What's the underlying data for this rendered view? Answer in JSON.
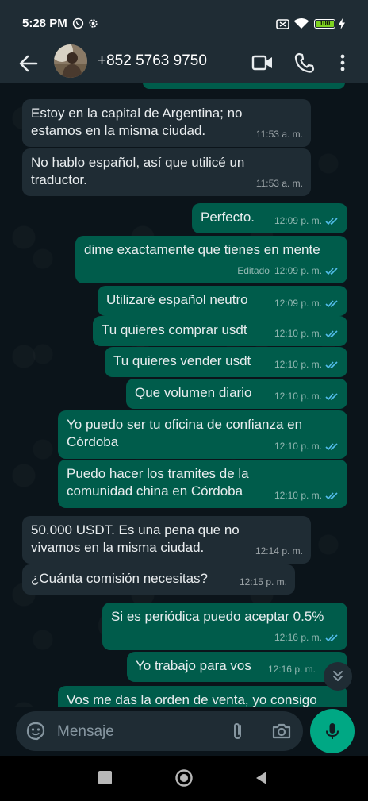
{
  "status_bar": {
    "time": "5:28 PM",
    "battery": "100",
    "icons": [
      "whatsapp-icon",
      "settings-gear-icon",
      "nfc-icon",
      "wifi-icon",
      "battery-icon",
      "charging-icon"
    ]
  },
  "header": {
    "contact": "+852 5763 9750",
    "icons": [
      "back-arrow-icon",
      "video-call-icon",
      "voice-call-icon",
      "more-vertical-icon"
    ]
  },
  "messages": [
    {
      "dir": "in",
      "text": "Estoy en la capital de Argentina; no\nestamos en la misma ciudad.",
      "time": "11:53 a. m."
    },
    {
      "dir": "in",
      "text": "No hablo español, así que utilicé un\ntraductor.",
      "time": "11:53 a. m."
    },
    {
      "dir": "out",
      "text": "Perfecto.",
      "time": "12:09 p. m.",
      "read": true
    },
    {
      "dir": "out",
      "text": "dime exactamente que tienes en mente",
      "time": "12:09 p. m.",
      "edited": "Editado",
      "read": true
    },
    {
      "dir": "out",
      "text": "Utilizaré español neutro",
      "time": "12:09 p. m.",
      "read": true
    },
    {
      "dir": "out",
      "text": "Tu quieres comprar usdt",
      "time": "12:10 p. m.",
      "read": true
    },
    {
      "dir": "out",
      "text": "Tu quieres vender usdt",
      "time": "12:10 p. m.",
      "read": true
    },
    {
      "dir": "out",
      "text": "Que volumen diario",
      "time": "12:10 p. m.",
      "read": true
    },
    {
      "dir": "out",
      "text": "Yo puedo ser tu oficina de confianza en\nCórdoba",
      "time": "12:10 p. m.",
      "read": true
    },
    {
      "dir": "out",
      "text": "Puedo hacer los tramites de la\ncomunidad china en Córdoba",
      "time": "12:10 p. m.",
      "read": true
    },
    {
      "dir": "in",
      "text": "50.000 USDT. Es una pena que no\nvivamos en la misma ciudad.",
      "time": "12:14 p. m."
    },
    {
      "dir": "in",
      "text": "¿Cuánta comisión necesitas?",
      "time": "12:15 p. m."
    },
    {
      "dir": "out",
      "text": "Si es periódica puedo aceptar 0.5%",
      "time": "12:16 p. m.",
      "read": true
    },
    {
      "dir": "out",
      "text": "Yo trabajo para vos",
      "time": "12:16 p. m.",
      "read": false
    },
    {
      "dir": "out",
      "text": "Vos me das la orden de venta, yo consigo",
      "time": "",
      "read": false
    }
  ],
  "composer": {
    "placeholder": "Mensaje",
    "icons": [
      "sticker-emoji-icon",
      "attach-paperclip-icon",
      "camera-icon",
      "microphone-icon"
    ]
  },
  "colors": {
    "background": "#0b141a",
    "bar": "#1f2c34",
    "incoming_bubble": "#1f2c34",
    "outgoing_bubble": "#005c4b",
    "accent": "#00a884",
    "read_ticks": "#53bdeb"
  }
}
